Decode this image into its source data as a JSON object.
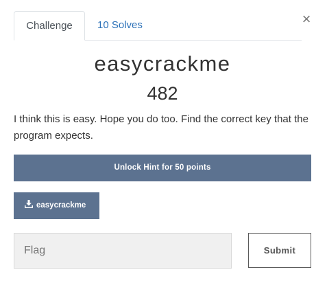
{
  "tabs": [
    {
      "label": "Challenge",
      "active": true
    },
    {
      "label": "10 Solves",
      "active": false
    }
  ],
  "close_label": "×",
  "challenge": {
    "name": "easycrackme",
    "value": "482",
    "description": "I think this is easy. Hope you do too. Find the correct key that the program expects."
  },
  "hint": {
    "label": "Unlock Hint for 50 points"
  },
  "files": [
    {
      "label": "easycrackme",
      "icon": "download-icon"
    }
  ],
  "flag": {
    "placeholder": "Flag",
    "value": ""
  },
  "submit_label": "Submit",
  "colors": {
    "button_bg": "#5c7290",
    "link": "#2c71b8",
    "input_bg": "#f0f0f0"
  }
}
